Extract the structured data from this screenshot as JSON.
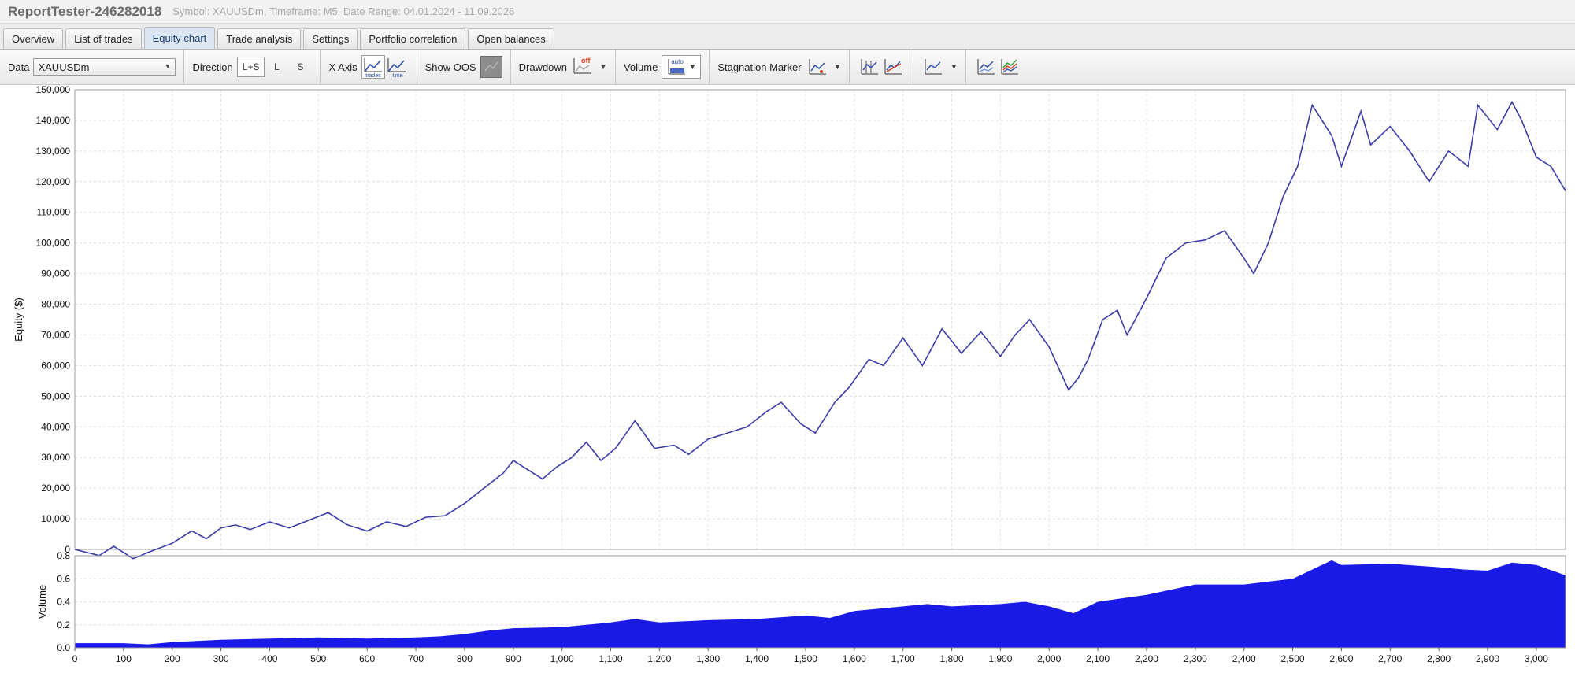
{
  "window": {
    "title": "ReportTester-246282018",
    "subtitle": "Symbol: XAUUSDm, Timeframe: M5, Date Range: 04.01.2024 - 11.09.2026"
  },
  "tabs": [
    {
      "label": "Overview",
      "active": false
    },
    {
      "label": "List of trades",
      "active": false
    },
    {
      "label": "Equity chart",
      "active": true
    },
    {
      "label": "Trade analysis",
      "active": false
    },
    {
      "label": "Settings",
      "active": false
    },
    {
      "label": "Portfolio correlation",
      "active": false
    },
    {
      "label": "Open balances",
      "active": false
    }
  ],
  "toolbar": {
    "data_label": "Data",
    "data_value": "XAUUSDm",
    "direction_label": "Direction",
    "direction_options": [
      "L+S",
      "L",
      "S"
    ],
    "direction_selected": "L+S",
    "xaxis_label": "X Axis",
    "xaxis_trades_text": "trades",
    "xaxis_time_text": "time",
    "show_oos_label": "Show OOS",
    "drawdown_label": "Drawdown",
    "drawdown_icon_text": "off",
    "volume_label": "Volume",
    "volume_icon_text": "auto",
    "stagnation_label": "Stagnation Marker"
  },
  "colors": {
    "equity_line": "#3a3aa8",
    "volume_fill": "#1a1ae6",
    "accent_tab": "#dbe6f2"
  },
  "chart_data": [
    {
      "type": "line",
      "ylabel": "Equity ($)",
      "xlim": [
        0,
        3060
      ],
      "ylim": [
        0,
        150000
      ],
      "y_ticks": [
        0,
        10000,
        20000,
        30000,
        40000,
        50000,
        60000,
        70000,
        80000,
        90000,
        100000,
        110000,
        120000,
        130000,
        140000,
        150000
      ],
      "y_tick_labels": [
        "0",
        "10,000",
        "20,000",
        "30,000",
        "40,000",
        "50,000",
        "60,000",
        "70,000",
        "80,000",
        "90,000",
        "100,000",
        "110,000",
        "120,000",
        "130,000",
        "140,000",
        "150,000"
      ],
      "grid": true,
      "series": [
        {
          "x": [
            0,
            50,
            80,
            120,
            150,
            200,
            240,
            270,
            300,
            330,
            360,
            400,
            440,
            480,
            520,
            560,
            600,
            640,
            680,
            720,
            760,
            800,
            840,
            880,
            900,
            930,
            960,
            990,
            1020,
            1050,
            1080,
            1110,
            1150,
            1190,
            1230,
            1260,
            1300,
            1340,
            1380,
            1420,
            1450,
            1490,
            1520,
            1560,
            1590,
            1630,
            1660,
            1700,
            1740,
            1780,
            1820,
            1860,
            1900,
            1930,
            1960,
            2000,
            2040,
            2060,
            2080,
            2110,
            2140,
            2160,
            2200,
            2240,
            2280,
            2320,
            2360,
            2400,
            2420,
            2450,
            2480,
            2510,
            2540,
            2580,
            2600,
            2640,
            2660,
            2700,
            2740,
            2780,
            2820,
            2860,
            2880,
            2920,
            2950,
            2970,
            3000,
            3030,
            3060
          ],
          "values": [
            0,
            -2000,
            1000,
            -3000,
            -1000,
            2000,
            6000,
            3500,
            7000,
            8000,
            6500,
            9000,
            7000,
            9500,
            12000,
            8000,
            6000,
            9000,
            7500,
            10500,
            11000,
            15000,
            20000,
            25000,
            29000,
            26000,
            23000,
            27000,
            30000,
            35000,
            29000,
            33000,
            42000,
            33000,
            34000,
            31000,
            36000,
            38000,
            40000,
            45000,
            48000,
            41000,
            38000,
            48000,
            53000,
            62000,
            60000,
            69000,
            60000,
            72000,
            64000,
            71000,
            63000,
            70000,
            75000,
            66000,
            52000,
            56000,
            62000,
            75000,
            78000,
            70000,
            82000,
            95000,
            100000,
            101000,
            104000,
            95000,
            90000,
            100000,
            115000,
            125000,
            145000,
            135000,
            125000,
            143000,
            132000,
            138000,
            130000,
            120000,
            130000,
            125000,
            145000,
            137000,
            146000,
            140000,
            128000,
            125000,
            117000
          ]
        }
      ]
    },
    {
      "type": "area",
      "ylabel": "Volume",
      "xlabel": "",
      "xlim": [
        0,
        3060
      ],
      "ylim": [
        0,
        0.8
      ],
      "y_ticks": [
        0,
        0.2,
        0.4,
        0.6,
        0.8
      ],
      "y_tick_labels": [
        "0.0",
        "0.2",
        "0.4",
        "0.6",
        "0.8"
      ],
      "x_ticks": [
        0,
        100,
        200,
        300,
        400,
        500,
        600,
        700,
        800,
        900,
        1000,
        1100,
        1200,
        1300,
        1400,
        1500,
        1600,
        1700,
        1800,
        1900,
        2000,
        2100,
        2200,
        2300,
        2400,
        2500,
        2600,
        2700,
        2800,
        2900,
        3000
      ],
      "x_tick_labels": [
        "0",
        "100",
        "200",
        "300",
        "400",
        "500",
        "600",
        "700",
        "800",
        "900",
        "1,000",
        "1,100",
        "1,200",
        "1,300",
        "1,400",
        "1,500",
        "1,600",
        "1,700",
        "1,800",
        "1,900",
        "2,000",
        "2,100",
        "2,200",
        "2,300",
        "2,400",
        "2,500",
        "2,600",
        "2,700",
        "2,800",
        "2,900",
        "3,000"
      ],
      "grid": true,
      "series": [
        {
          "x": [
            0,
            100,
            150,
            200,
            300,
            400,
            500,
            600,
            700,
            750,
            800,
            850,
            900,
            1000,
            1100,
            1150,
            1200,
            1300,
            1400,
            1500,
            1550,
            1600,
            1700,
            1750,
            1800,
            1900,
            1950,
            2000,
            2050,
            2100,
            2200,
            2300,
            2400,
            2500,
            2550,
            2580,
            2600,
            2700,
            2800,
            2850,
            2900,
            2950,
            3000,
            3060
          ],
          "values": [
            0.04,
            0.04,
            0.03,
            0.05,
            0.07,
            0.08,
            0.09,
            0.08,
            0.09,
            0.1,
            0.12,
            0.15,
            0.17,
            0.18,
            0.22,
            0.25,
            0.22,
            0.24,
            0.25,
            0.28,
            0.26,
            0.32,
            0.36,
            0.38,
            0.36,
            0.38,
            0.4,
            0.36,
            0.3,
            0.4,
            0.46,
            0.55,
            0.55,
            0.6,
            0.7,
            0.76,
            0.72,
            0.73,
            0.7,
            0.68,
            0.67,
            0.74,
            0.72,
            0.63
          ]
        }
      ]
    }
  ]
}
